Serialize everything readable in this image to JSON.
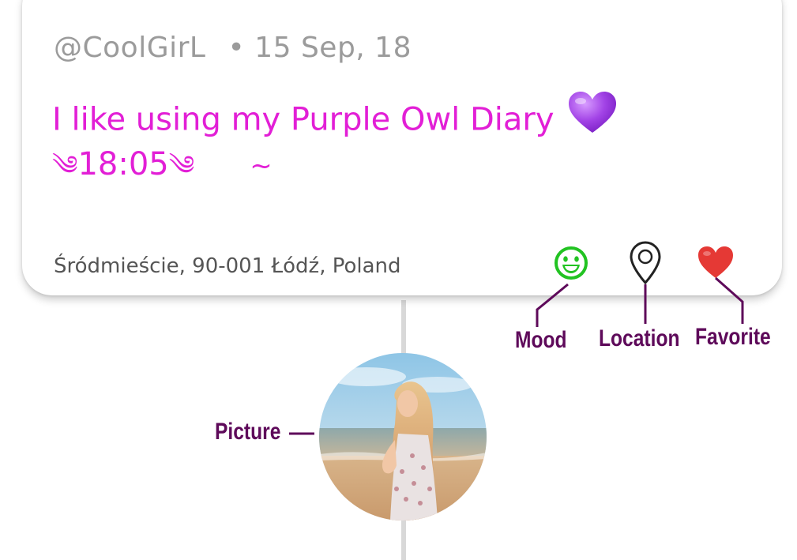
{
  "entry": {
    "username": "@CoolGirL",
    "separator": "•",
    "date": "15 Sep, 18",
    "text": "I like using my Purple Owl Diary",
    "time_flourish_left": "༄",
    "time": "18:05",
    "time_flourish_right": "༄",
    "tilde": "~",
    "location": "Śródmieście, 90-001 Łódź, Poland"
  },
  "icons": {
    "text_emoji": "purple-heart-icon",
    "mood": "smiley-face-icon",
    "location": "map-pin-icon",
    "favorite": "heart-icon"
  },
  "labels": {
    "mood": "Mood",
    "location": "Location",
    "favorite": "Favorite",
    "picture": "Picture"
  },
  "colors": {
    "entry_text": "#e21fd6",
    "meta_text": "#9b9b9b",
    "mood_icon": "#22c322",
    "favorite_icon": "#e53935",
    "label": "#5e0a5a",
    "purple_heart": "#a243e6"
  }
}
